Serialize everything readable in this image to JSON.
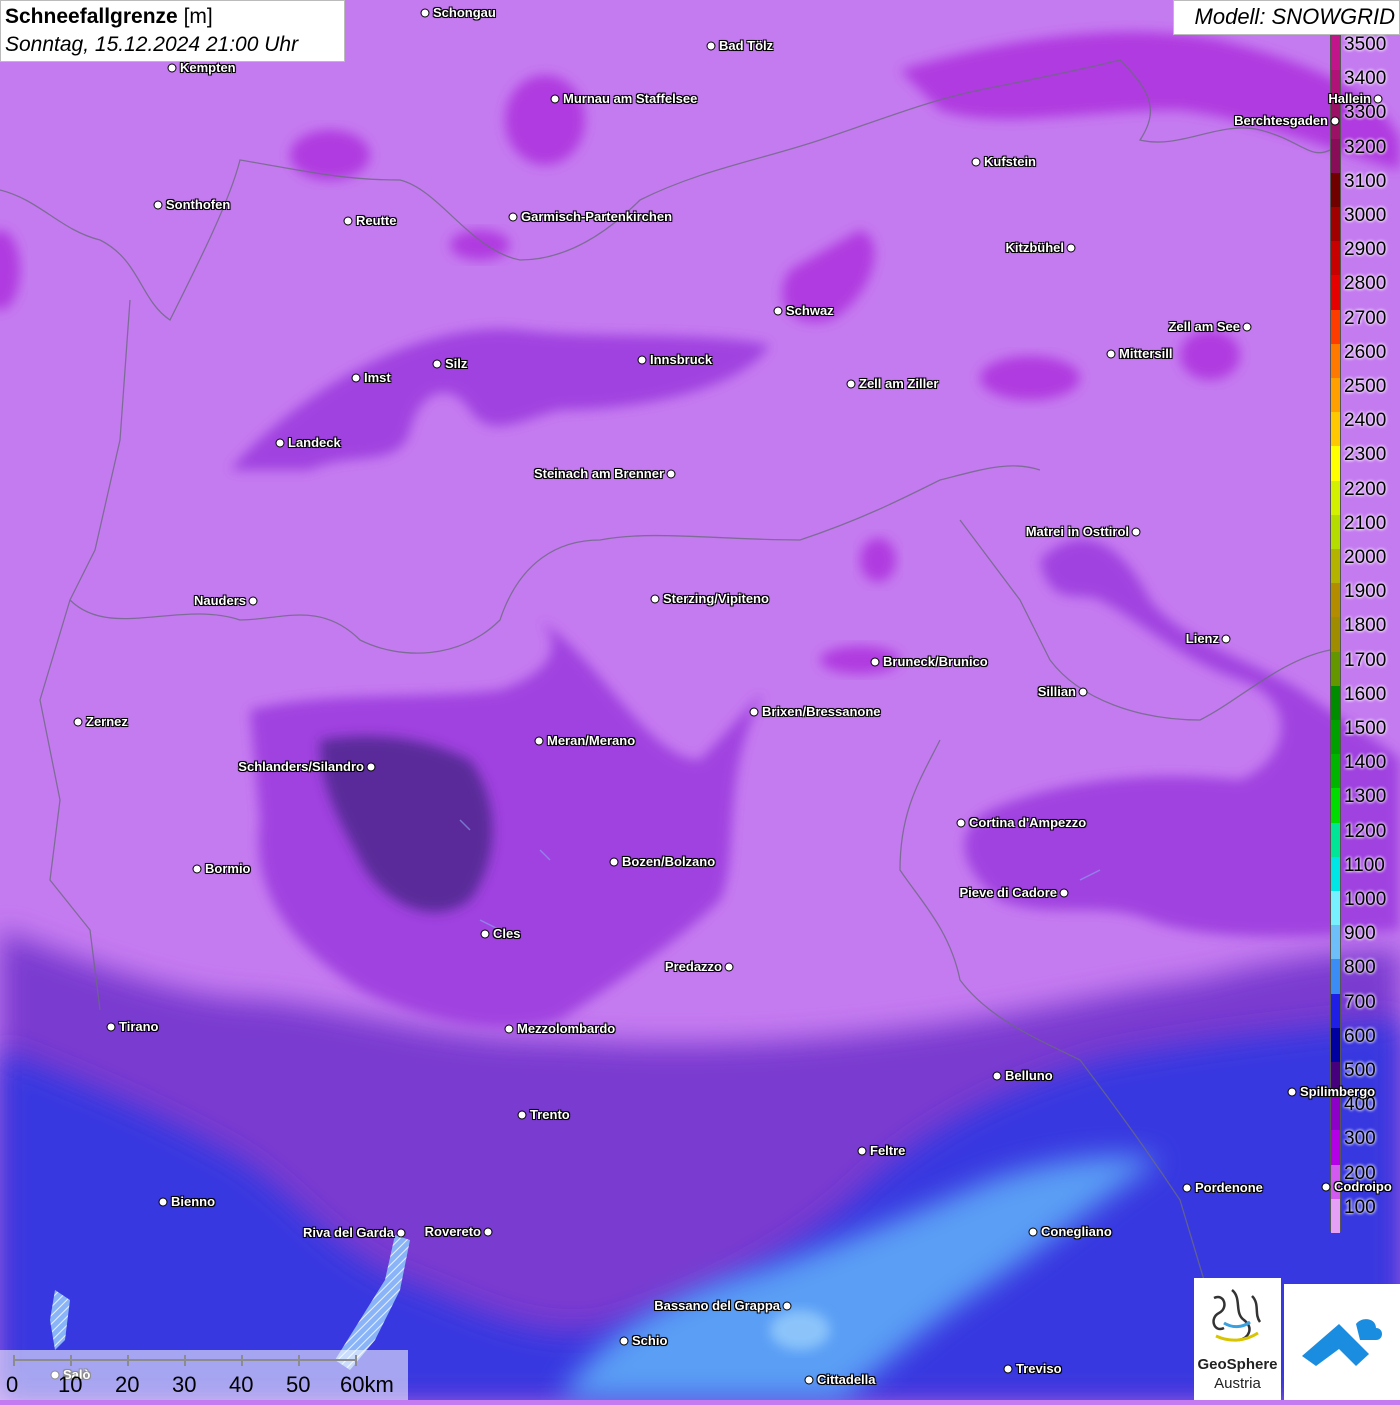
{
  "title": {
    "main": "Schneefallgrenze",
    "unit": "[m]",
    "datetime": "Sonntag, 15.12.2024 21:00 Uhr"
  },
  "model_label": "Modell: SNOWGRID",
  "legend": {
    "labels": [
      "3500",
      "3400",
      "3300",
      "3200",
      "3100",
      "3000",
      "2900",
      "2800",
      "2700",
      "2600",
      "2500",
      "2400",
      "2300",
      "2200",
      "2100",
      "2000",
      "1900",
      "1800",
      "1700",
      "1600",
      "1500",
      "1400",
      "1300",
      "1200",
      "1100",
      "1000",
      "900",
      "800",
      "700",
      "600",
      "500",
      "400",
      "300",
      "200",
      "100"
    ],
    "colors": [
      "#c4148c",
      "#b01278",
      "#9c1066",
      "#880c58",
      "#700000",
      "#a00000",
      "#c80000",
      "#e60000",
      "#ff3c00",
      "#ff7800",
      "#ffa000",
      "#ffc800",
      "#ffff00",
      "#d2f000",
      "#b4dc00",
      "#b4b400",
      "#b48c00",
      "#a08c00",
      "#649600",
      "#008c00",
      "#00a000",
      "#00b400",
      "#00dc00",
      "#00e696",
      "#00e6e6",
      "#78f0ff",
      "#6ebefa",
      "#3c8cf5",
      "#1e1ee6",
      "#0000a0",
      "#46007d",
      "#8c00c8",
      "#b400e6",
      "#d25af0",
      "#e6a0f5"
    ]
  },
  "cities": [
    {
      "name": "Schongau"
    },
    {
      "name": "Bad Tölz"
    },
    {
      "name": "Kempten"
    },
    {
      "name": "Murnau am Staffelsee"
    },
    {
      "name": "Berchtesgaden"
    },
    {
      "name": "Kufstein"
    },
    {
      "name": "Sonthofen"
    },
    {
      "name": "Reutte"
    },
    {
      "name": "Garmisch-Partenkirchen"
    },
    {
      "name": "Kitzbühel"
    },
    {
      "name": "Schwaz"
    },
    {
      "name": "Zell am See"
    },
    {
      "name": "Innsbruck"
    },
    {
      "name": "Silz"
    },
    {
      "name": "Mittersill"
    },
    {
      "name": "Imst"
    },
    {
      "name": "Zell am Ziller"
    },
    {
      "name": "Landeck"
    },
    {
      "name": "Steinach am Brenner"
    },
    {
      "name": "Matrei in Osttirol"
    },
    {
      "name": "Nauders"
    },
    {
      "name": "Sterzing/Vipiteno"
    },
    {
      "name": "Lienz"
    },
    {
      "name": "Bruneck/Brunico"
    },
    {
      "name": "Sillian"
    },
    {
      "name": "Zernez"
    },
    {
      "name": "Brixen/Bressanone"
    },
    {
      "name": "Meran/Merano"
    },
    {
      "name": "Schlanders/Silandro"
    },
    {
      "name": "Cortina d'Ampezzo"
    },
    {
      "name": "Bozen/Bolzano"
    },
    {
      "name": "Bormio"
    },
    {
      "name": "Pieve di Cadore"
    },
    {
      "name": "Cles"
    },
    {
      "name": "Predazzo"
    },
    {
      "name": "Tirano"
    },
    {
      "name": "Mezzolombardo"
    },
    {
      "name": "Belluno"
    },
    {
      "name": "Spilimbergo"
    },
    {
      "name": "Trento"
    },
    {
      "name": "Feltre"
    },
    {
      "name": "Pordenone"
    },
    {
      "name": "Bienno"
    },
    {
      "name": "Riva del Garda"
    },
    {
      "name": "Rovereto"
    },
    {
      "name": "Conegliano"
    },
    {
      "name": "Bassano del Grappa"
    },
    {
      "name": "Schio"
    },
    {
      "name": "Treviso"
    },
    {
      "name": "Cittadella"
    },
    {
      "name": "Hallein"
    },
    {
      "name": "Codroipo"
    },
    {
      "name": "Salò"
    }
  ],
  "scale": {
    "ticks": [
      "0",
      "10",
      "20",
      "30",
      "40",
      "50",
      "60km"
    ]
  },
  "logos": {
    "geosphere_line1": "GeoSphere",
    "geosphere_line2": "Austria"
  }
}
